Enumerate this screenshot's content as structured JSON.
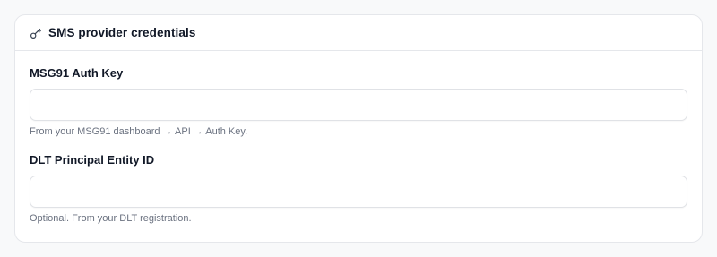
{
  "card": {
    "icon": "key-icon",
    "title": "SMS provider credentials"
  },
  "fields": [
    {
      "label": "MSG91 Auth Key",
      "value": "",
      "placeholder": "",
      "help": "From your MSG91 dashboard → API → Auth Key."
    },
    {
      "label": "DLT Principal Entity ID",
      "value": "",
      "placeholder": "",
      "help": "Optional. From your DLT registration."
    }
  ],
  "colors": {
    "card_border": "#e5e7eb",
    "text_primary": "#111827",
    "text_muted": "#6b7280",
    "page_background": "#f8f9fa"
  }
}
